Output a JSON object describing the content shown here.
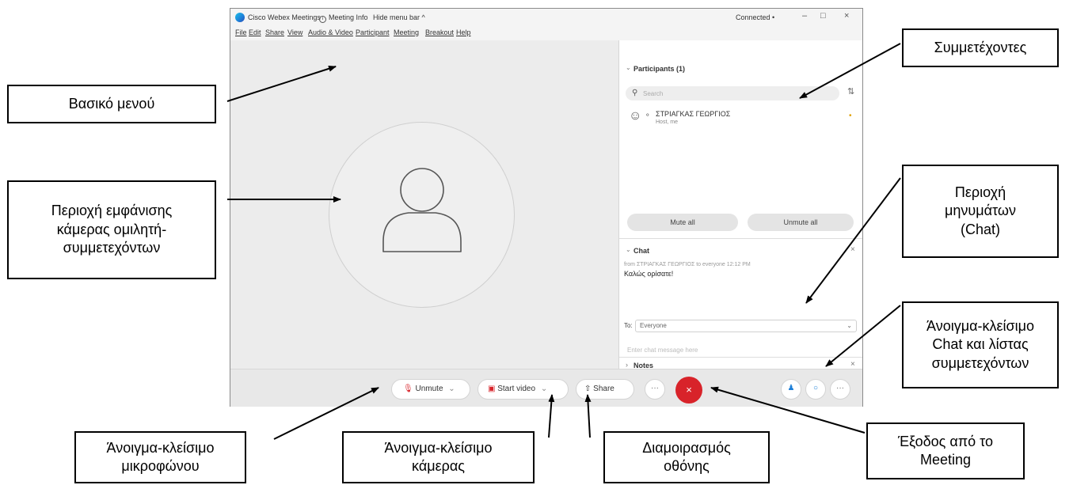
{
  "window": {
    "app_title": "Cisco Webex Meetings",
    "meeting_info": "Meeting Info",
    "hide_menu_bar": "Hide menu bar ^",
    "connection_status": "Connected •",
    "minimize": "–",
    "maximize": "□",
    "close": "×"
  },
  "menu": {
    "items": [
      "File",
      "Edit",
      "Share",
      "View",
      "Audio & Video",
      "Participant",
      "Meeting",
      "Breakout",
      "Help"
    ]
  },
  "participants": {
    "header": "Participants (1)",
    "search_placeholder": "Search",
    "list": [
      {
        "name": "ΣΤΡΙΑΓΚΑΣ ΓΕΩΡΓΙΟΣ",
        "role": "Host, me"
      }
    ],
    "mute_all": "Mute all",
    "unmute_all": "Unmute all"
  },
  "chat": {
    "header": "Chat",
    "message_meta": "from ΣΤΡΙΑΓΚΑΣ ΓΕΩΡΓΙΟΣ to everyone   12:12 PM",
    "message_text": "Καλώς ορίσατε!",
    "to_label": "To:",
    "to_value": "Everyone",
    "input_placeholder": "Enter chat message here"
  },
  "notes": {
    "header": "Notes"
  },
  "toolbar": {
    "unmute": "Unmute",
    "start_video": "Start video",
    "share": "Share",
    "more": "···",
    "leave": "×"
  },
  "annotations": {
    "main_menu": "Βασικό μενού",
    "camera_area": [
      "Περιοχή εμφάνισης",
      "κάμερας ομιλητή-",
      "συμμετεχόντων"
    ],
    "participants": "Συμμετέχοντες",
    "chat_area": [
      "Περιοχή",
      "μηνυμάτων",
      "(Chat)"
    ],
    "toggle_chat": [
      "Άνοιγμα-κλείσιμο",
      "Chat  και λίστας",
      "συμμετεχόντων"
    ],
    "toggle_mic": [
      "Άνοιγμα-κλείσιμο",
      "μικροφώνου"
    ],
    "toggle_camera": [
      "Άνοιγμα-κλείσιμο",
      "κάμερας"
    ],
    "screen_share": [
      "Διαμοιρασμός",
      "οθόνης"
    ],
    "leave_meeting": [
      "Έξοδος από το",
      "Meeting"
    ]
  }
}
